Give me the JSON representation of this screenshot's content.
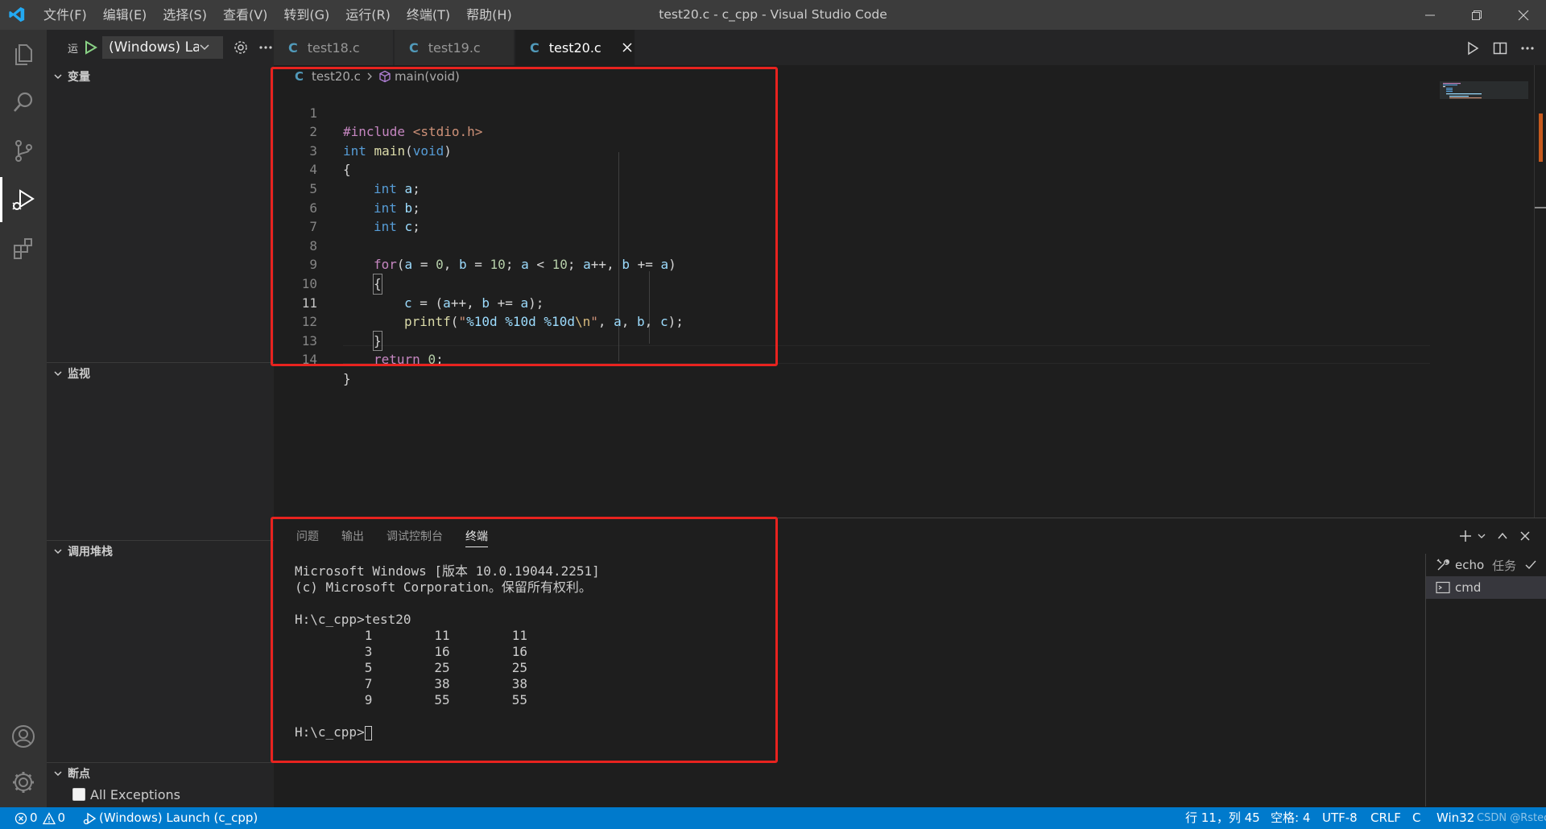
{
  "window": {
    "title": "test20.c - c_cpp - Visual Studio Code",
    "menu": [
      "文件(F)",
      "编辑(E)",
      "选择(S)",
      "查看(V)",
      "转到(G)",
      "运行(R)",
      "终端(T)",
      "帮助(H)"
    ]
  },
  "sidebar": {
    "run_label_short": "运",
    "config": "(Windows) Launch",
    "sections": {
      "variables": "变量",
      "watch": "监视",
      "call_stack": "调用堆栈",
      "breakpoints": "断点"
    },
    "breakpoint_item": "All Exceptions"
  },
  "tabs": [
    {
      "label": "test18.c"
    },
    {
      "label": "test19.c"
    },
    {
      "label": "test20.c"
    }
  ],
  "breadcrumb": {
    "file": "test20.c",
    "symbol": "main(void)"
  },
  "editor": {
    "current_line": 11,
    "lines": [
      {
        "n": "1"
      },
      {
        "n": "2"
      },
      {
        "n": "3"
      },
      {
        "n": "4"
      },
      {
        "n": "5"
      },
      {
        "n": "6"
      },
      {
        "n": "7"
      },
      {
        "n": "8"
      },
      {
        "n": "9"
      },
      {
        "n": "10"
      },
      {
        "n": "11"
      },
      {
        "n": "12"
      },
      {
        "n": "13"
      },
      {
        "n": "14"
      }
    ],
    "code": {
      "l1": {
        "a": "#include ",
        "b": "<stdio.h>"
      },
      "l2": {
        "a": "int",
        "b": " ",
        "c": "main",
        "d": "(",
        "e": "void",
        "f": ")"
      },
      "l3": "{",
      "l4": {
        "a": "int",
        "b": " ",
        "c": "a",
        "d": ";"
      },
      "l5": {
        "a": "int",
        "b": " ",
        "c": "b",
        "d": ";"
      },
      "l6": {
        "a": "int",
        "b": " ",
        "c": "c",
        "d": ";"
      },
      "l8": {
        "kw": "for",
        "p1": "(",
        "a": "a",
        "eq1": " = ",
        "z": "0",
        "p2": ", ",
        "b": "b",
        "eq2": " = ",
        "ten": "10",
        "p3": "; ",
        "a2": "a",
        "lt": " < ",
        "ten2": "10",
        "p4": "; ",
        "a3": "a",
        "pp": "++, ",
        "b2": "b",
        "pe": " += ",
        "a4": "a",
        "p5": ")"
      },
      "l9": "{",
      "l10": {
        "c": "c",
        "eq": " = (",
        "a": "a",
        "pp": "++, ",
        "b": "b",
        "pe": " += ",
        "a2": "a",
        "end": ");"
      },
      "l11": {
        "fn": "printf",
        "p1": "(",
        "s1": "\"",
        "e1": "%10d",
        "sp1": " ",
        "e2": "%10d",
        "sp2": " ",
        "e3": "%10d",
        "e4": "\\n",
        "s2": "\"",
        "p2": ", ",
        "a": "a",
        "c1": ", ",
        "b": "b",
        "c2": ", ",
        "c": "c",
        "end": ");"
      },
      "l12": "}",
      "l13": {
        "kw": "return",
        "sp": " ",
        "z": "0",
        "end": ";"
      },
      "l14": "}"
    }
  },
  "panel": {
    "tabs": [
      "问题",
      "输出",
      "调试控制台",
      "终端"
    ],
    "active_tab": "终端",
    "terminal_lines": [
      "Microsoft Windows [版本 10.0.19044.2251]",
      "(c) Microsoft Corporation。保留所有权利。",
      "",
      "H:\\c_cpp>test20",
      "         1        11        11",
      "         3        16        16",
      "         5        25        25",
      "         7        38        38",
      "         9        55        55",
      ""
    ],
    "prompt": "H:\\c_cpp>",
    "terminals": [
      {
        "label": "echo",
        "extra": "任务"
      },
      {
        "label": "cmd"
      }
    ]
  },
  "statusbar": {
    "errors": "0",
    "warnings": "0",
    "launch": "(Windows) Launch (c_cpp)",
    "position": "行 11，列 45",
    "spaces": "空格: 4",
    "encoding": "UTF-8",
    "eol": "CRLF",
    "language": "C",
    "platform": "Win32",
    "watermark": "CSDN @Rsteck"
  },
  "colors": {
    "highlight_box": "#e8231f",
    "status_bar": "#007acc",
    "activity_bar": "#333333",
    "sidebar": "#252526",
    "editor": "#1e1e1e"
  }
}
